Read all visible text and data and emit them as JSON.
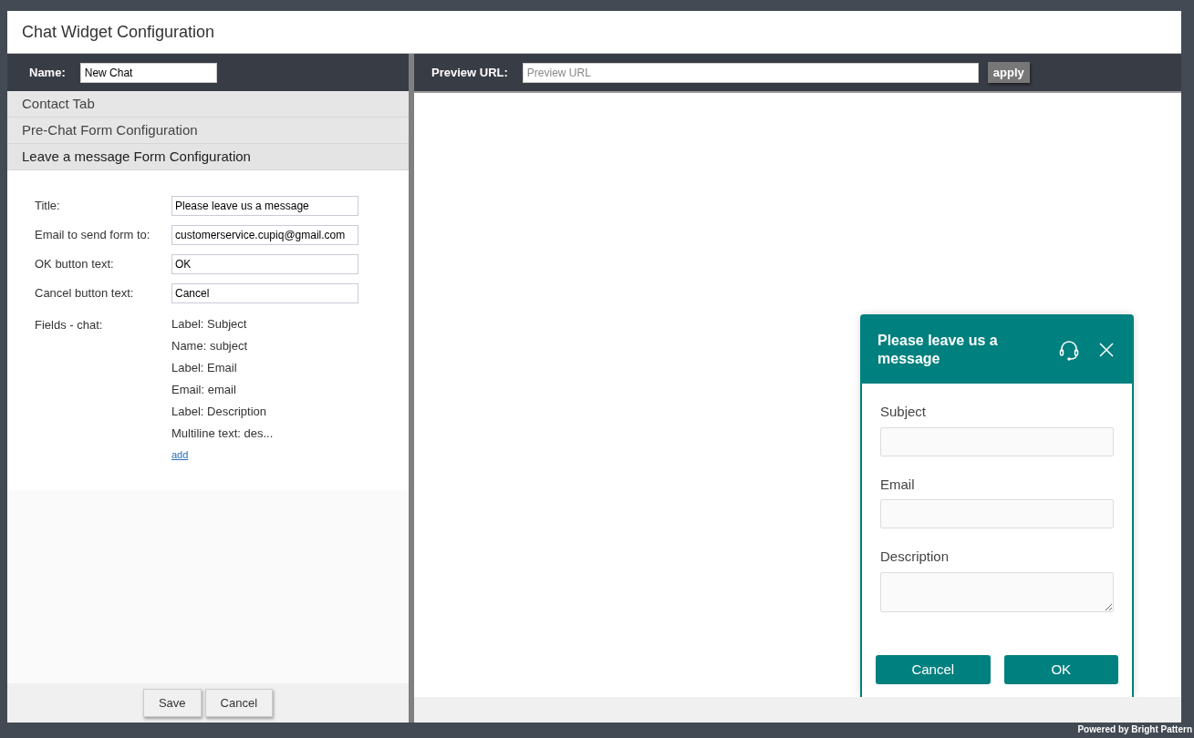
{
  "window": {
    "title": "Chat Widget Configuration"
  },
  "name_field": {
    "label": "Name:",
    "value": "New Chat"
  },
  "preview_url": {
    "label": "Preview URL:",
    "placeholder": "Preview URL",
    "button": "apply"
  },
  "sections": [
    {
      "label": "Contact Tab",
      "expanded": false
    },
    {
      "label": "Pre-Chat Form Configuration",
      "expanded": false
    },
    {
      "label": "Leave a message Form Configuration",
      "expanded": true
    }
  ],
  "form": {
    "rows": [
      {
        "label": "Title:",
        "value": "Please leave us a message"
      },
      {
        "label": "Email to send form to:",
        "value": "customerservice.cupiq@gmail.com"
      },
      {
        "label": "OK button text:",
        "value": "OK"
      },
      {
        "label": "Cancel button text:",
        "value": "Cancel"
      }
    ],
    "fields_label": "Fields - chat:",
    "fields": [
      "Label: Subject",
      "Name: subject",
      "Label: Email",
      "Email: email",
      "Label: Description",
      "Multiline text: des..."
    ],
    "add_link": "add"
  },
  "footer_buttons": [
    "Save",
    "Cancel"
  ],
  "widget": {
    "title": "Please leave us a message",
    "fields": [
      {
        "label": "Subject",
        "kind": "text"
      },
      {
        "label": "Email",
        "kind": "text"
      },
      {
        "label": "Description",
        "kind": "multiline"
      }
    ],
    "buttons": [
      "Cancel",
      "OK"
    ]
  },
  "powered_by": "Powered by Bright Pattern"
}
